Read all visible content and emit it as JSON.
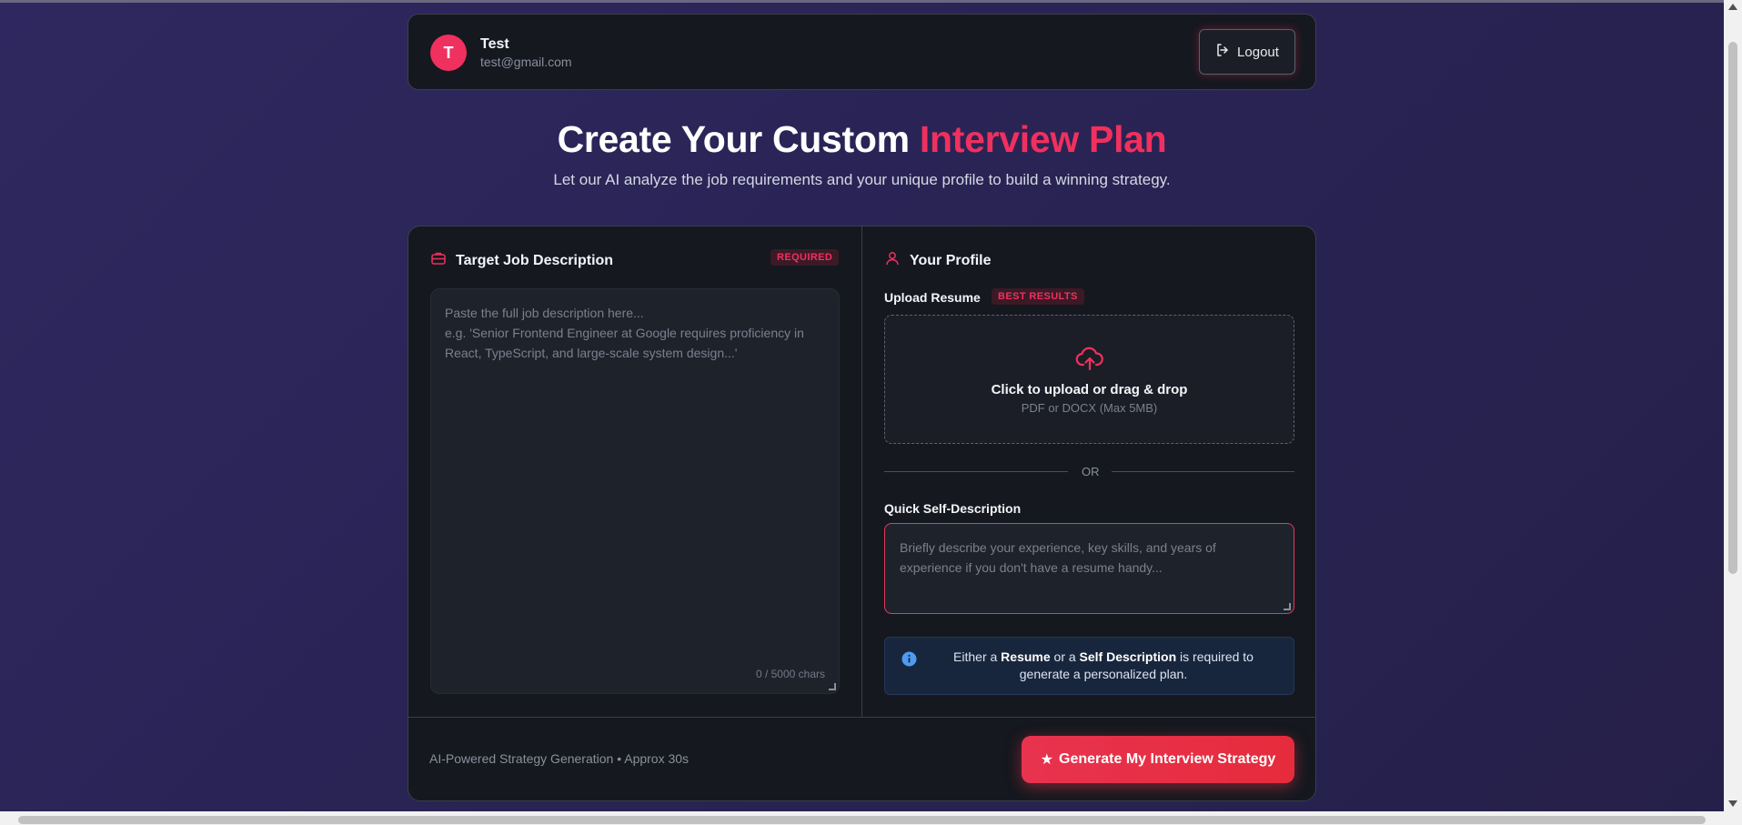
{
  "user": {
    "avatar_letter": "T",
    "name": "Test",
    "email": "test@gmail.com",
    "logout_label": "Logout"
  },
  "hero": {
    "title_prefix": "Create Your Custom ",
    "title_accent": "Interview Plan",
    "subtitle": "Let our AI analyze the job requirements and your unique profile to build a winning strategy."
  },
  "job_description": {
    "title": "Target Job Description",
    "badge": "REQUIRED",
    "placeholder": "Paste the full job description here...\ne.g. 'Senior Frontend Engineer at Google requires proficiency in React, TypeScript, and large-scale system design...'",
    "char_count": "0 / 5000 chars"
  },
  "profile": {
    "title": "Your Profile",
    "upload_label": "Upload Resume",
    "upload_badge": "BEST RESULTS",
    "upload_title": "Click to upload or drag & drop",
    "upload_sub": "PDF or DOCX (Max 5MB)",
    "or_text": "OR",
    "self_desc_label": "Quick Self-Description",
    "self_desc_placeholder": "Briefly describe your experience, key skills, and years of experience if you don't have a resume handy...",
    "info": {
      "t1": "Either a ",
      "b1": "Resume",
      "t2": " or a ",
      "b2": "Self Description",
      "t3": " is required to generate a personalized plan."
    }
  },
  "footer": {
    "note": "AI-Powered Strategy Generation • Approx 30s",
    "generate_label": "Generate My Interview Strategy",
    "generate_icon": "★"
  },
  "colors": {
    "accent": "#f0305e",
    "background": "#2a2456",
    "card": "#15181f"
  }
}
